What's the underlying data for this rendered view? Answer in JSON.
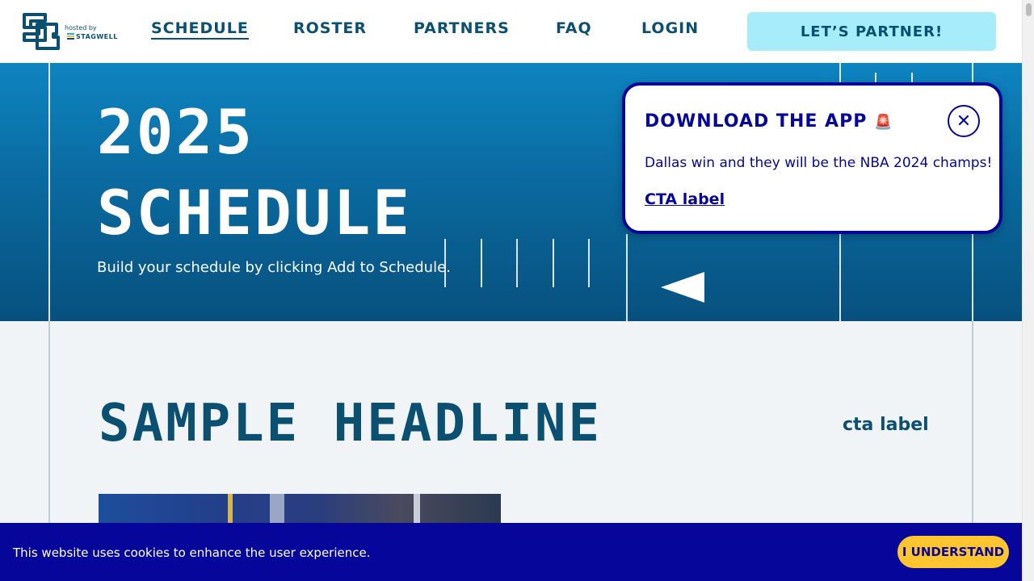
{
  "header": {
    "logo_hosted_by": "hosted by",
    "logo_partner": "STAGWELL",
    "nav": [
      {
        "label": "SCHEDULE",
        "active": true
      },
      {
        "label": "ROSTER",
        "active": false
      },
      {
        "label": "PARTNERS",
        "active": false
      },
      {
        "label": "FAQ",
        "active": false
      },
      {
        "label": "LOGIN",
        "active": false
      }
    ],
    "partner_button": "LET’S PARTNER!"
  },
  "hero": {
    "title_line1": "2025",
    "title_line2": "SCHEDULE",
    "subtitle": "Build your schedule by clicking Add to Schedule."
  },
  "popup": {
    "title": "DOWNLOAD THE APP",
    "title_icon": "siren-icon",
    "body": "Dallas win and they will be the NBA 2024 champs!",
    "cta": "CTA label",
    "close_icon": "close-icon"
  },
  "content": {
    "headline": "SAMPLE HEADLINE",
    "headline_cta": "cta label"
  },
  "cookie_banner": {
    "text": "This website uses cookies to enhance the user experience.",
    "button": "I UNDERSTAND"
  },
  "colors": {
    "brand_navy": "#0b4f71",
    "hero_blue": "#0a6aa0",
    "popup_blue": "#06069a",
    "partner_cyan": "#a6ecfb",
    "cookie_button_yellow": "#ffc52e",
    "page_background": "#f0f4f7"
  }
}
